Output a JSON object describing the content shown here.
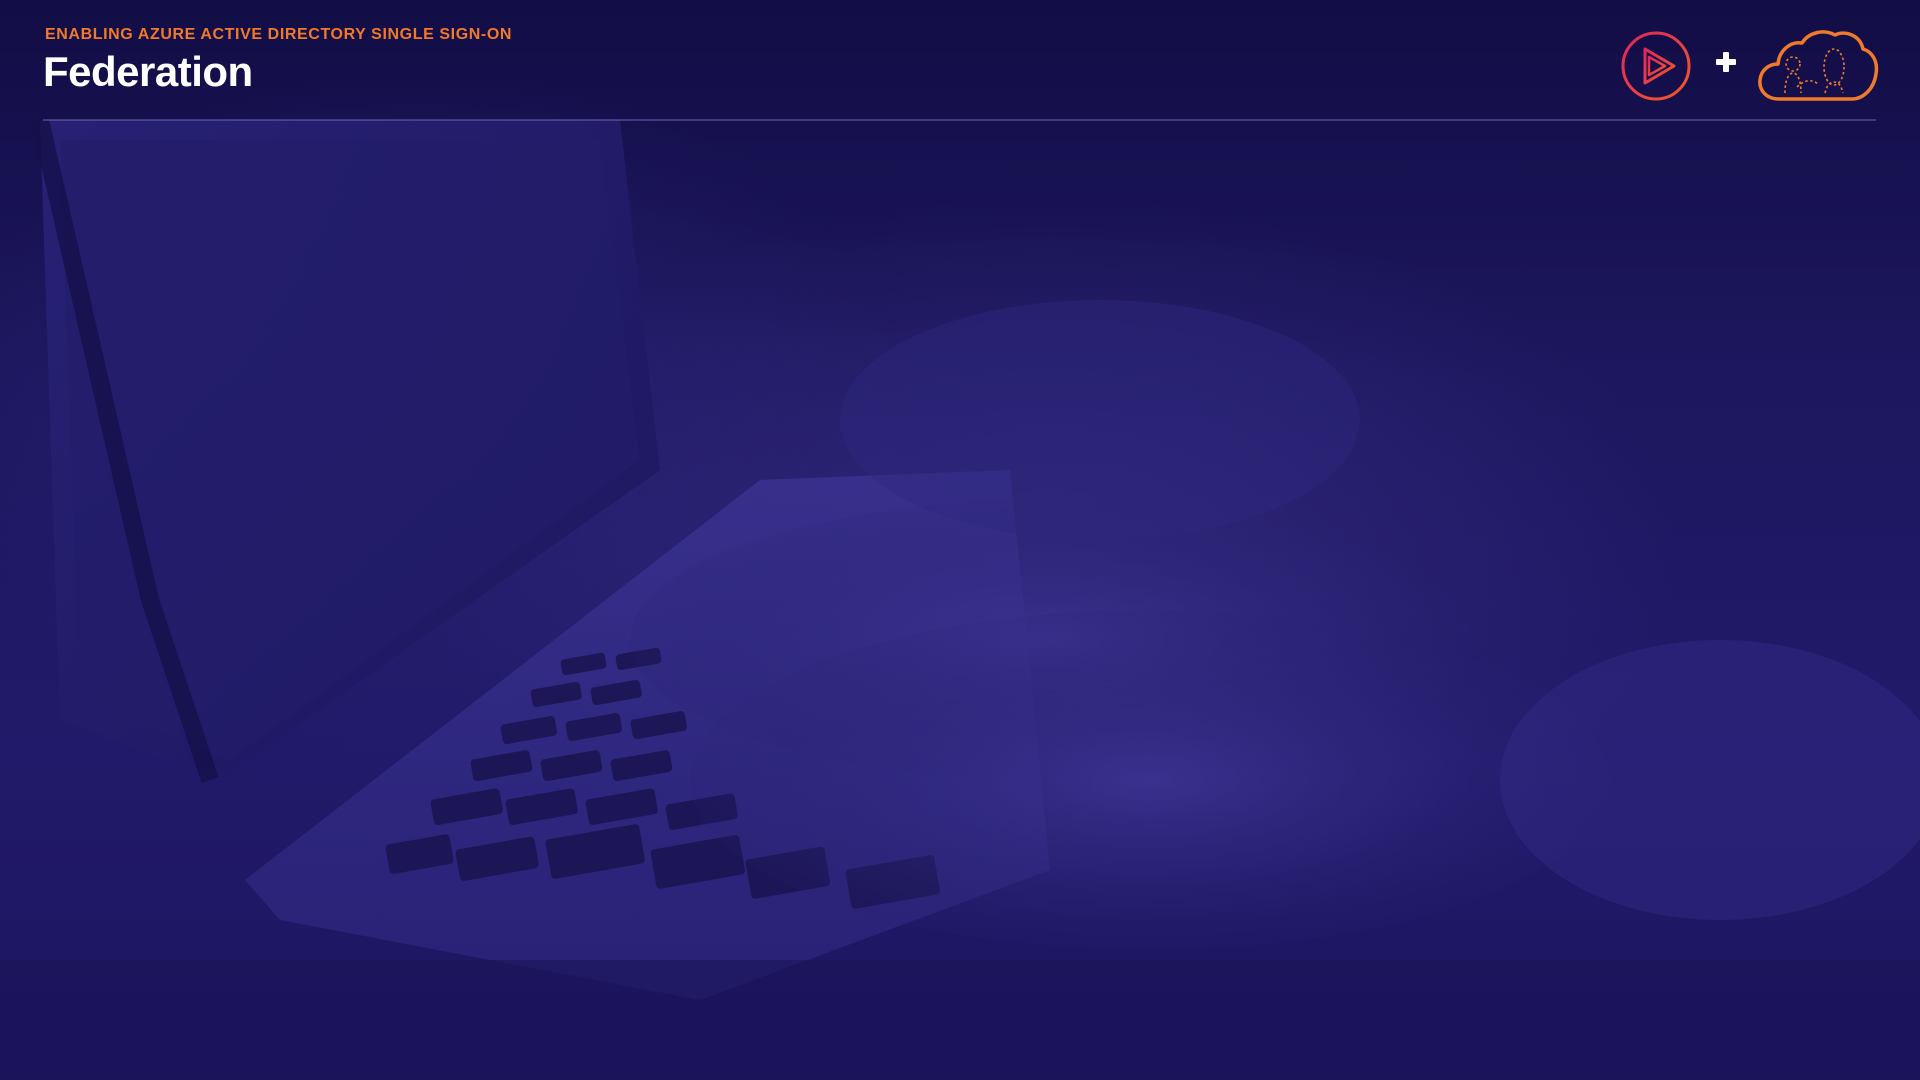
{
  "slide": {
    "eyebrow": "ENABLING AZURE ACTIVE DIRECTORY SINGLE SIGN-ON",
    "title": "Federation"
  },
  "icons": {
    "left_logo": "pluralsight-play-icon",
    "separator": "plus-icon",
    "right_logo": "cloud-people-icon"
  },
  "colors": {
    "accent_orange": "#f07a2b",
    "play_gradient_start": "#e0245e",
    "play_gradient_end": "#f05a28",
    "background_navy": "#1a1356",
    "title_white": "#ffffff"
  }
}
